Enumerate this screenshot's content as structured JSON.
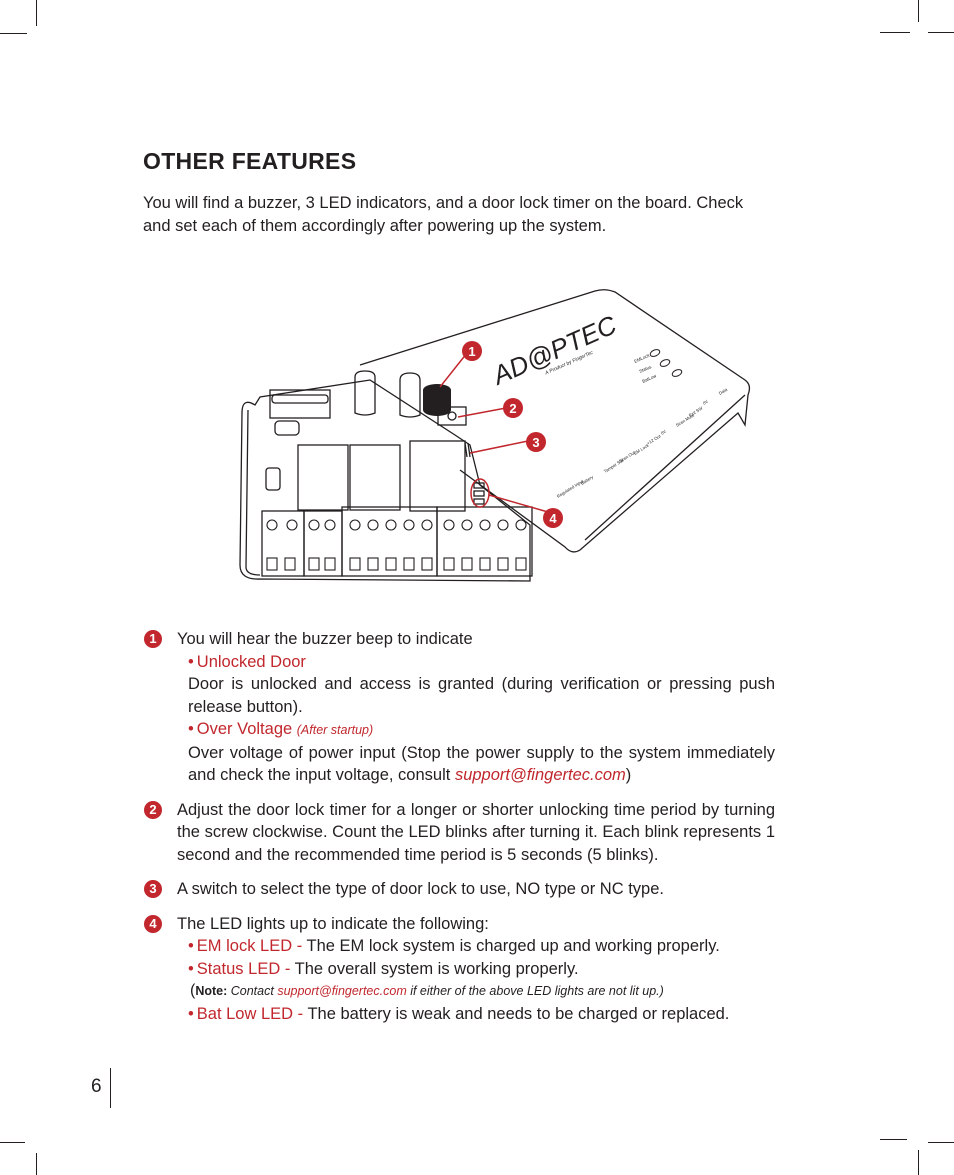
{
  "section": {
    "title": "OTHER FEATURES",
    "intro": "You will find a buzzer, 3 LED indicators, and a door lock timer on the board.  Check and set each of them accordingly after powering up the system."
  },
  "figure": {
    "brand": "AD@PTEC",
    "tagline": "A Product by FingerTec",
    "led_labels": [
      "EMLock",
      "Status",
      "BatLow"
    ],
    "terminal_labels": [
      "Regulated Input",
      "Battery",
      "Tamper SW",
      "Siren Out",
      "EM Lock",
      "+12 Out",
      "0V",
      "Siren Mute",
      "Exit SW",
      "0V",
      "Data"
    ],
    "callouts": [
      "1",
      "2",
      "3",
      "4"
    ]
  },
  "features": [
    {
      "number": "1",
      "lead": "You will hear the buzzer beep to indicate",
      "subitems": [
        {
          "bullet": "•",
          "heading": "Unlocked Door",
          "qualifier": "",
          "body": "Door is unlocked and access is granted (during verification or pressing push release button)."
        },
        {
          "bullet": "•",
          "heading": "Over Voltage",
          "qualifier": "(After startup)",
          "body_before": "Over voltage of power input (Stop the power supply to the system immediately and check the input voltage, consult ",
          "email": "support@fingertec.com",
          "body_after": ")"
        }
      ]
    },
    {
      "number": "2",
      "text": "Adjust the door lock timer for a longer or shorter unlocking time period by turning the screw clockwise. Count the LED blinks after turning it. Each blink represents 1 second and the recommended time period is 5 seconds (5 blinks)."
    },
    {
      "number": "3",
      "text": "A switch to select the type of door lock to use, NO type or NC type."
    },
    {
      "number": "4",
      "lead": "The LED lights up to indicate the following:",
      "leds": [
        {
          "bullet": "•",
          "name": "EM lock LED -",
          "desc": "The EM lock system is charged up and working properly."
        },
        {
          "bullet": "•",
          "name": "Status LED -",
          "desc": "The overall system is working properly."
        },
        {
          "bullet": "•",
          "name": "Bat Low LED -",
          "desc": "The battery is weak and needs to be charged or replaced."
        }
      ],
      "note": {
        "open": "(",
        "label": "Note:",
        "before": " Contact ",
        "email": "support@fingertec.com",
        "after": " if either of the above LED lights are not lit up.)"
      }
    }
  ],
  "footer": {
    "page_number": "6"
  },
  "colors": {
    "accent": "#c1272d",
    "text": "#231f20"
  }
}
